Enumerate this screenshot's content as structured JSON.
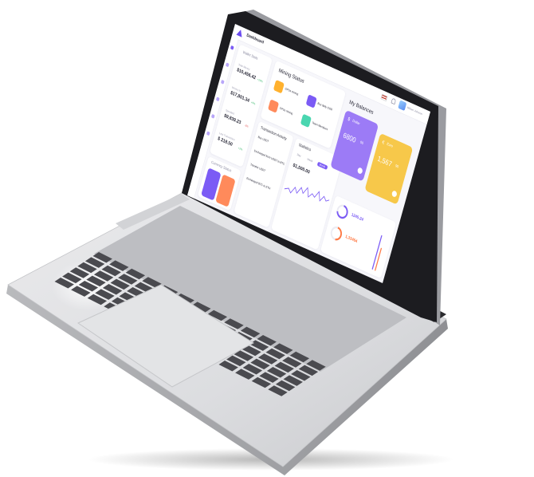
{
  "header": {
    "title": "Dashboard",
    "user": "William Johnson"
  },
  "nav": {
    "items": [
      "home-icon",
      "chart-icon",
      "wallet-icon",
      "swap-icon",
      "user-icon",
      "settings-icon"
    ]
  },
  "wallet_stats": {
    "title": "Wallet Stats",
    "items": [
      {
        "label": "Total Money",
        "value": "$10,456.42",
        "change": "+20%",
        "positive": true
      },
      {
        "label": "Money In",
        "value": "$17,801.34",
        "change": "+5%",
        "positive": true
      },
      {
        "label": "Spended",
        "value": "$9,839.23",
        "change": "-3%",
        "positive": false
      },
      {
        "label": "Last Transaction",
        "value": "$ 218.50",
        "change": "+2%",
        "positive": true
      }
    ]
  },
  "currency_status": {
    "title": "Currency Status"
  },
  "mining_status": {
    "title": "Mining Status",
    "items": [
      {
        "label": "GPUs mining",
        "color": "#ffb12e"
      },
      {
        "label": "Buy daily GGD",
        "color": "#7b5bf5"
      },
      {
        "label": "CPUs mining",
        "color": "#ff8a5b"
      },
      {
        "label": "Team Members",
        "color": "#4ad6b0"
      }
    ]
  },
  "balances": {
    "title": "My Balances",
    "cards": [
      {
        "symbol": "$",
        "currency": "Dollar",
        "value": "6800",
        "cents": "00",
        "color": "#9c7bf6"
      },
      {
        "symbol": "€",
        "currency": "Euro",
        "value": "1,567",
        "cents": "90",
        "color": "#f7c84a"
      }
    ]
  },
  "transactions": {
    "title": "Transaction Activity",
    "items": [
      "Buy USDT",
      "Exchanged from USDT to BTC",
      "Transfer USDT",
      "Exchanged BTC to ETH"
    ]
  },
  "statistics": {
    "title": "Statistics",
    "tabs": [
      "Day",
      "Week",
      "Month"
    ],
    "active_tab": "Month",
    "value": "$1,500.00"
  },
  "gauges": [
    {
      "value": "1245.24",
      "color": "#7b5bf5"
    },
    {
      "value": "1,33464",
      "color": "#ff7a45"
    }
  ],
  "palette": {
    "accent": "#7b5bf5",
    "laptop_body": "#d9dadd",
    "bezel": "#1c1c20"
  }
}
